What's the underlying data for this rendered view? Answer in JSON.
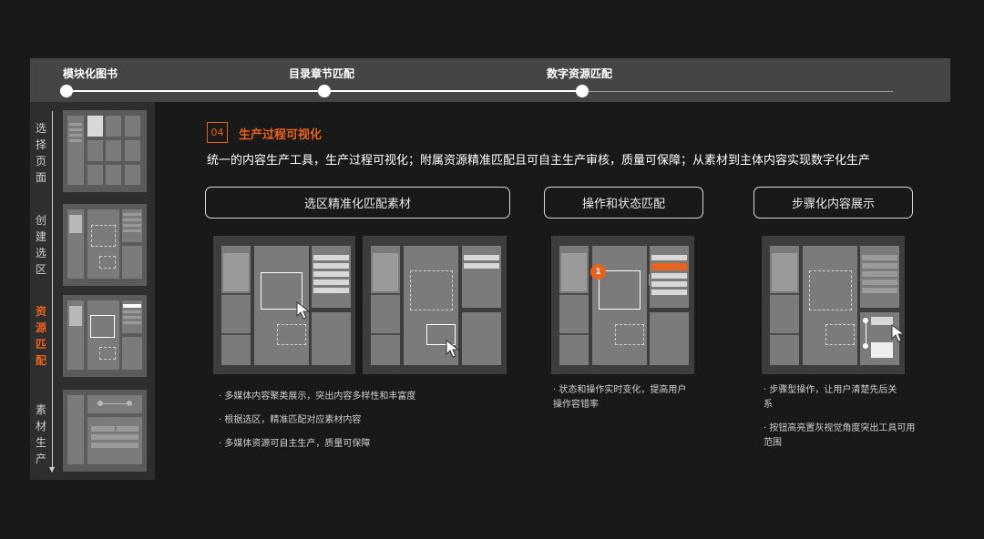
{
  "stepper": {
    "steps": [
      {
        "label": "模块化图书"
      },
      {
        "label": "目录章节匹配"
      },
      {
        "label": "数字资源匹配"
      }
    ]
  },
  "sidebar": {
    "steps": [
      {
        "label": "选择页面"
      },
      {
        "label": "创建选区"
      },
      {
        "label": "资源匹配",
        "active": true
      },
      {
        "label": "素材生产"
      }
    ]
  },
  "section": {
    "number": "04",
    "title": "生产过程可视化",
    "description": "统一的内容生产工具，生产过程可视化；附属资源精准匹配且可自主生产审核，质量可保障；从素材到主体内容实现数字化生产"
  },
  "features": [
    {
      "title": "选区精准化匹配素材",
      "notes": [
        "· 多媒体内容聚类展示，突出内容多样性和丰富度",
        "· 根据选区，精准匹配对应素材内容",
        "· 多媒体资源可自主生产，质量可保障"
      ]
    },
    {
      "title": "操作和状态匹配",
      "badge": "1",
      "notes": [
        "· 状态和操作实时变化，提高用户操作容错率"
      ]
    },
    {
      "title": "步骤化内容展示",
      "notes": [
        "·  步骤型操作，让用户清楚先后关系",
        "·  按钮高亮置灰视觉角度突出工具可用范围"
      ]
    }
  ],
  "colors": {
    "accent": "#e8621e",
    "background": "#191919",
    "bar": "#454545"
  }
}
